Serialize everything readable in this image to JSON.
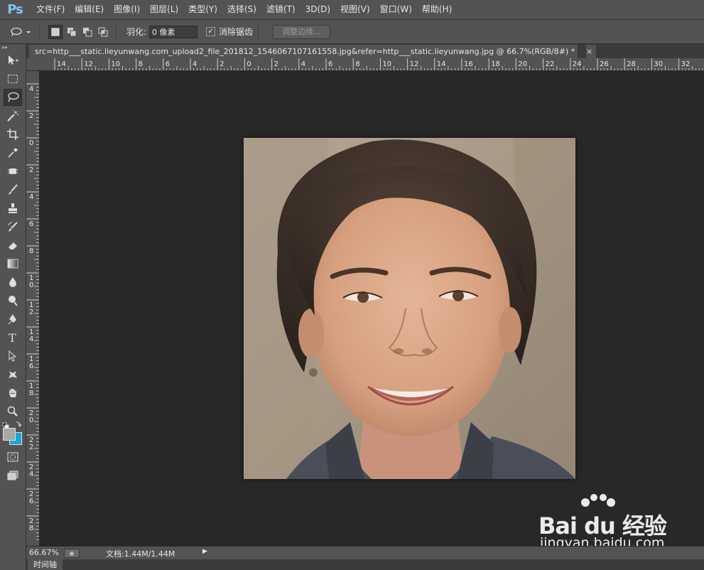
{
  "app": {
    "logo": "Ps"
  },
  "menubar": {
    "items": [
      "文件(F)",
      "编辑(E)",
      "图像(I)",
      "图层(L)",
      "类型(Y)",
      "选择(S)",
      "滤镜(T)",
      "3D(D)",
      "视图(V)",
      "窗口(W)",
      "帮助(H)"
    ]
  },
  "options": {
    "feather_label": "羽化:",
    "feather_value": "0 像素",
    "antialias_label": "消除锯齿",
    "antialias_checked": "✓",
    "refine_edge_label": "调整边缘..."
  },
  "document": {
    "tab_title": "src=http___static.lieyunwang.com_upload2_file_201812_1546067107161558.jpg&refer=http___static.lieyunwang.jpg @ 66.7%(RGB/8#) *",
    "close": "×"
  },
  "ruler_top": {
    "labels": [
      "14",
      "12",
      "10",
      "8",
      "6",
      "4",
      "2",
      "0",
      "2",
      "4",
      "6",
      "8",
      "10",
      "12",
      "14",
      "16",
      "18",
      "20",
      "22",
      "24",
      "26",
      "28",
      "30",
      "32"
    ]
  },
  "ruler_left": {
    "labels": [
      "4",
      "2",
      "0",
      "2",
      "4",
      "6",
      "8",
      "1\n0",
      "1\n2",
      "1\n4",
      "1\n6",
      "1\n8",
      "2\n0",
      "2\n2",
      "2\n4",
      "2\n6",
      "2\n8"
    ]
  },
  "status": {
    "zoom": "66.67%",
    "doc_size": "文档:1.44M/1.44M",
    "arrow": "▶"
  },
  "bottom_panel": {
    "timeline_tab": "时间轴"
  },
  "watermark": {
    "brand": "Bai du 经验",
    "url": "jingyan.baidu.com"
  },
  "colors": {
    "foreground": "#a8a8a8",
    "background": "#1aa7d8",
    "ps_blue": "#7ec3ef"
  }
}
